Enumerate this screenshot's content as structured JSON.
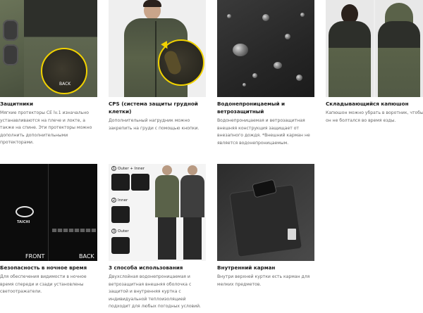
{
  "cards": [
    {
      "title": "Защитники",
      "desc": "Мягкие протекторы CE lv.1 изначально устанавливаются на плече и локте, а также на спине. Эти протекторы можно дополнить дополнительными протекторами.",
      "image_label": "BACK"
    },
    {
      "title": "CPS (система защиты грудной клетки)",
      "desc": "Дополнительный нагрудник можно закрепить на груди с помощью кнопки."
    },
    {
      "title": "Водонепроницаемый и ветрозащитный",
      "desc": "Водонепроницаемая и ветрозащитная внешняя конструкция защищает от внезапного дождя. *Внешний карман не является водонепроницаемым."
    },
    {
      "title": "Складывающийся капюшон",
      "desc": "Капюшон можно убрать в воротник, чтобы он не болтался во время езды."
    },
    {
      "title": "Безопасность в ночное время",
      "desc": "Для обеспечения видимости в ночное время спереди и сзади установлены светоотражатели.",
      "front_label": "FRONT",
      "back_label": "BACK",
      "brand_text": "TAICHI"
    },
    {
      "title": "3 способа использования",
      "desc": "Двухслойная водонепроницаемая и ветрозащитная внешняя оболочка с защитой и внутренняя куртка с индивидуальной теплоизоляцией подходит для любых погодных условий.",
      "steps": [
        {
          "num": "1",
          "label": "Outer + Inner"
        },
        {
          "num": "2",
          "label": "Inner"
        },
        {
          "num": "3",
          "label": "Outer"
        }
      ]
    },
    {
      "title": "Внутренний карман",
      "desc": "Внутри верхней куртки есть карман для мелких предметов."
    }
  ],
  "colors": {
    "highlight": "#f1d200",
    "olive": "#5a6249",
    "title": "#1a1a1a",
    "desc": "#666666"
  }
}
